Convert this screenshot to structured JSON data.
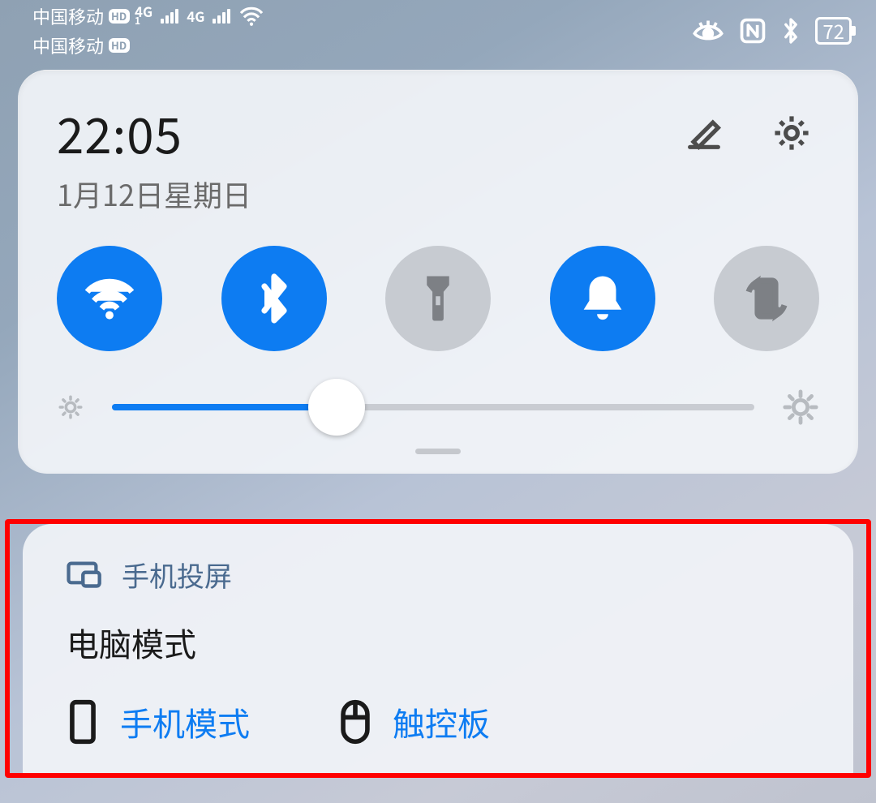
{
  "status": {
    "carrier1": "中国移动",
    "carrier2": "中国移动",
    "hd": "HD",
    "net": "4G",
    "battery": "72"
  },
  "qs": {
    "time": "22:05",
    "date": "1月12日星期日",
    "brightness_pct": 35,
    "toggles": {
      "wifi": {
        "name": "wifi",
        "on": true
      },
      "bt": {
        "name": "bluetooth",
        "on": true
      },
      "torch": {
        "name": "flashlight",
        "on": false
      },
      "bell": {
        "name": "sound",
        "on": true
      },
      "rotate": {
        "name": "auto-rotate",
        "on": false
      }
    }
  },
  "projection": {
    "title": "手机投屏",
    "mode_label": "电脑模式",
    "actions": {
      "phone_mode": "手机模式",
      "touchpad": "触控板"
    }
  }
}
